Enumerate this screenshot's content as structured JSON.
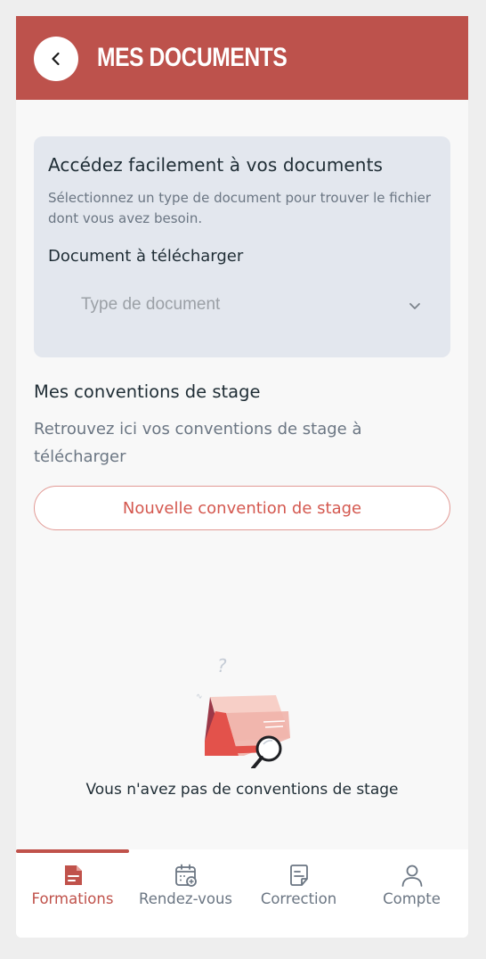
{
  "header": {
    "title": "MES DOCUMENTS"
  },
  "card": {
    "title": "Accédez facilement à vos documents",
    "description": "Sélectionnez un type de document pour trouver le fichier dont vous avez besoin.",
    "label": "Document à télécharger",
    "select_placeholder": "Type de document"
  },
  "conventions": {
    "title": "Mes conventions de stage",
    "description": "Retrouvez ici vos conventions de stage à télécharger",
    "new_button": "Nouvelle convention de stage",
    "empty_text": "Vous n'avez pas de conventions de stage"
  },
  "tabs": [
    {
      "label": "Formations",
      "icon": "document-icon",
      "active": true
    },
    {
      "label": "Rendez-vous",
      "icon": "calendar-icon",
      "active": false
    },
    {
      "label": "Correction",
      "icon": "file-icon",
      "active": false
    },
    {
      "label": "Compte",
      "icon": "user-icon",
      "active": false
    }
  ],
  "colors": {
    "header": "#bd524c",
    "accent": "#c0524b",
    "card_bg": "#e3e7ee"
  }
}
